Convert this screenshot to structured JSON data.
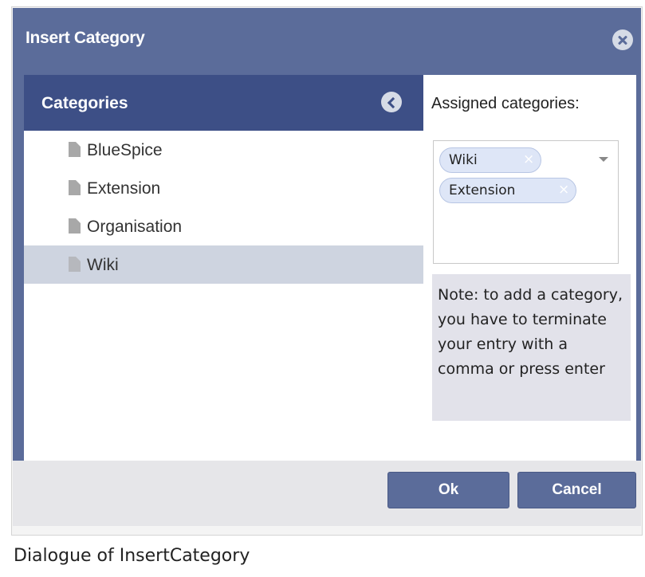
{
  "dialog": {
    "title": "Insert Category",
    "close_icon": "close-circle-icon"
  },
  "categories_panel": {
    "header": "Categories",
    "collapse_icon": "chevron-left-circle-icon",
    "items": [
      {
        "label": "BlueSpice",
        "icon": "file-icon",
        "selected": false
      },
      {
        "label": "Extension",
        "icon": "file-icon",
        "selected": false
      },
      {
        "label": "Organisation",
        "icon": "file-icon",
        "selected": false
      },
      {
        "label": "Wiki",
        "icon": "file-icon",
        "selected": true
      }
    ]
  },
  "assigned": {
    "label": "Assigned categories:",
    "tags": [
      {
        "label": "Wiki",
        "remove": "×"
      },
      {
        "label": "Extension",
        "remove": "×"
      }
    ],
    "dropdown_icon": "chevron-down-icon"
  },
  "note": "Note: to add a category, you have to terminate your entry with a comma or press enter",
  "buttons": {
    "ok": "Ok",
    "cancel": "Cancel"
  },
  "caption": "Dialogue of InsertCategory",
  "colors": {
    "titlebar": "#5b6c9a",
    "panel_header": "#3d4f86",
    "selected_row": "#ced4e0",
    "tag_bg": "#dee6f7",
    "note_bg": "#e2e2ea"
  }
}
